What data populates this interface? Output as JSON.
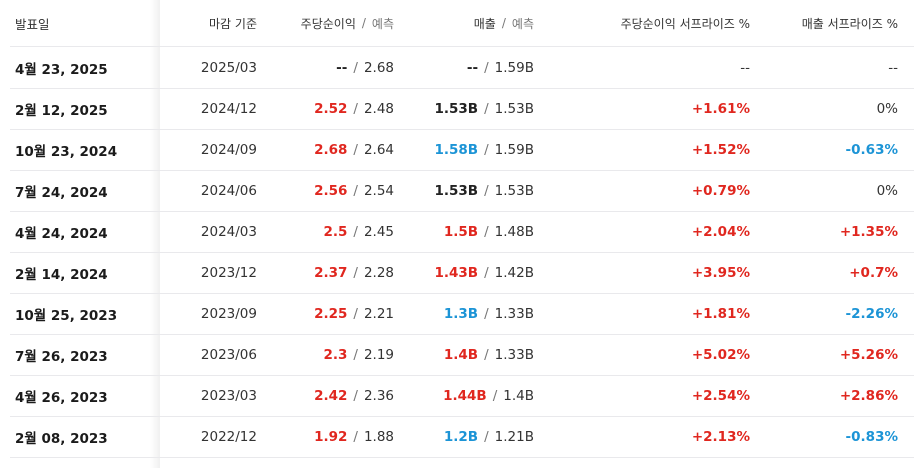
{
  "headers": {
    "date": "발표일",
    "period": "마감 기준",
    "eps": "주당순이익",
    "eps_sub": "예측",
    "revenue": "매출",
    "revenue_sub": "예측",
    "eps_surprise": "주당순이익 서프라이즈 %",
    "revenue_surprise": "매출 서프라이즈 %"
  },
  "separator": "/",
  "colors": {
    "positive": "#e0271f",
    "negative": "#1c94d6",
    "neutral": "#222222"
  },
  "rows": [
    {
      "date": "4월 23, 2025",
      "period": "2025/03",
      "eps_actual": "--",
      "eps_est": "2.68",
      "rev_actual": "--",
      "rev_est": "1.59B",
      "eps_surprise": "--",
      "rev_surprise": "--"
    },
    {
      "date": "2월 12, 2025",
      "period": "2024/12",
      "eps_actual": "2.52",
      "eps_est": "2.48",
      "rev_actual": "1.53B",
      "rev_est": "1.53B",
      "eps_surprise": "+1.61%",
      "rev_surprise": "0%"
    },
    {
      "date": "10월 23, 2024",
      "period": "2024/09",
      "eps_actual": "2.68",
      "eps_est": "2.64",
      "rev_actual": "1.58B",
      "rev_est": "1.59B",
      "eps_surprise": "+1.52%",
      "rev_surprise": "-0.63%"
    },
    {
      "date": "7월 24, 2024",
      "period": "2024/06",
      "eps_actual": "2.56",
      "eps_est": "2.54",
      "rev_actual": "1.53B",
      "rev_est": "1.53B",
      "eps_surprise": "+0.79%",
      "rev_surprise": "0%"
    },
    {
      "date": "4월 24, 2024",
      "period": "2024/03",
      "eps_actual": "2.5",
      "eps_est": "2.45",
      "rev_actual": "1.5B",
      "rev_est": "1.48B",
      "eps_surprise": "+2.04%",
      "rev_surprise": "+1.35%"
    },
    {
      "date": "2월 14, 2024",
      "period": "2023/12",
      "eps_actual": "2.37",
      "eps_est": "2.28",
      "rev_actual": "1.43B",
      "rev_est": "1.42B",
      "eps_surprise": "+3.95%",
      "rev_surprise": "+0.7%"
    },
    {
      "date": "10월 25, 2023",
      "period": "2023/09",
      "eps_actual": "2.25",
      "eps_est": "2.21",
      "rev_actual": "1.3B",
      "rev_est": "1.33B",
      "eps_surprise": "+1.81%",
      "rev_surprise": "-2.26%"
    },
    {
      "date": "7월 26, 2023",
      "period": "2023/06",
      "eps_actual": "2.3",
      "eps_est": "2.19",
      "rev_actual": "1.4B",
      "rev_est": "1.33B",
      "eps_surprise": "+5.02%",
      "rev_surprise": "+5.26%"
    },
    {
      "date": "4월 26, 2023",
      "period": "2023/03",
      "eps_actual": "2.42",
      "eps_est": "2.36",
      "rev_actual": "1.44B",
      "rev_est": "1.4B",
      "eps_surprise": "+2.54%",
      "rev_surprise": "+2.86%"
    },
    {
      "date": "2월 08, 2023",
      "period": "2022/12",
      "eps_actual": "1.92",
      "eps_est": "1.88",
      "rev_actual": "1.2B",
      "rev_est": "1.21B",
      "eps_surprise": "+2.13%",
      "rev_surprise": "-0.83%"
    }
  ]
}
